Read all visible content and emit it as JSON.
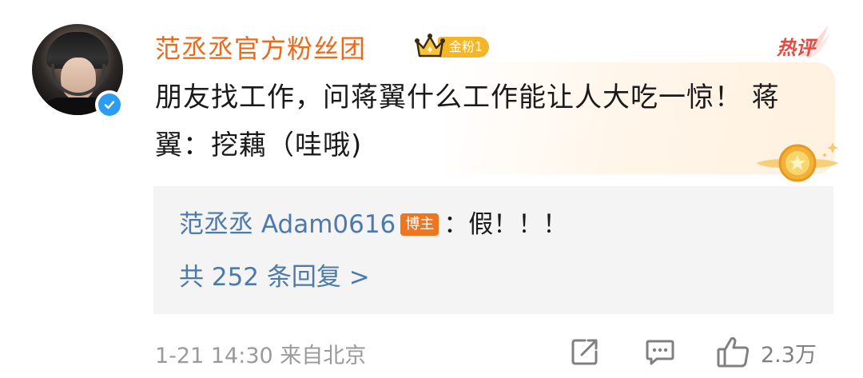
{
  "comment": {
    "author": "范丞丞官方粉丝团",
    "fan_badge_label": "金粉1",
    "hot_tag": "热评",
    "text": "朋友找工作，问蒋翼什么工作能让人大吃一惊！ 蒋翼：挖藕（哇哦)",
    "timestamp": "1-21 14:30",
    "location": "来自北京",
    "like_count": "2.3万"
  },
  "reply": {
    "author": "范丞丞 Adam0616",
    "author_badge": "博主",
    "text": "：假！！！",
    "more_label": "共 252 条回复 >"
  },
  "icons": {
    "avatar": "avatar-photo",
    "verified": "verified-check-icon",
    "crown": "crown-icon",
    "hot": "hot-comment-wing-icon",
    "medal": "gold-medal-icon",
    "share": "share-icon",
    "comment": "comment-icon",
    "like": "thumbs-up-icon"
  },
  "colors": {
    "author_name": "#eb6a1a",
    "link_blue": "#4d7aab",
    "badge_orange": "#f0751f",
    "fan_badge_gold": "#f2b628",
    "hot_red": "#e8493f",
    "verified_blue": "#2b9cf2"
  }
}
